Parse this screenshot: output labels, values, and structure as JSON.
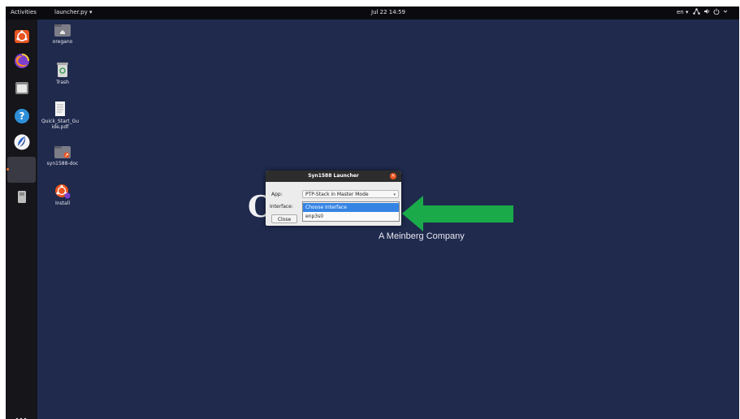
{
  "topbar": {
    "activities": "Activities",
    "app_menu": "launcher.py ▾",
    "clock": "Jul 22  14:59",
    "language": "en ▾",
    "tray_icons": [
      "network-icon",
      "volume-icon",
      "power-icon",
      "chevron-down-icon"
    ]
  },
  "dock": {
    "items": [
      "ubuntu-software-icon",
      "firefox-icon",
      "files-icon",
      "help-icon",
      "app-icon",
      "active-app-icon",
      "usb-drive-icon"
    ],
    "show_apps": "show-apps-grid-icon"
  },
  "desktop": {
    "icons": [
      {
        "label": "oregano",
        "icon": "home-folder-icon"
      },
      {
        "label": "Trash",
        "icon": "trash-icon"
      },
      {
        "label": "Quick_Start_Gu\nide.pdf",
        "icon": "pdf-document-icon"
      },
      {
        "label": "syn1588-doc",
        "icon": "folder-link-icon"
      },
      {
        "label": "Install",
        "icon": "ubuntu-installer-icon"
      }
    ]
  },
  "background": {
    "partial_logo_letter": "C",
    "company": "A Meinberg Company"
  },
  "dialog": {
    "title": "Syn1588 Launcher",
    "app_label": "App:",
    "app_value": "PTP-Stack in Master Mode",
    "interface_label": "Interface:",
    "interface_options": [
      "Choose Interface",
      "enp3s0"
    ],
    "selected_index": 0,
    "close_label": "Close"
  },
  "colors": {
    "desktop": "#1f2a4d",
    "arrow": "#1aaa4a",
    "selection": "#3584e4",
    "accent": "#e95420"
  }
}
